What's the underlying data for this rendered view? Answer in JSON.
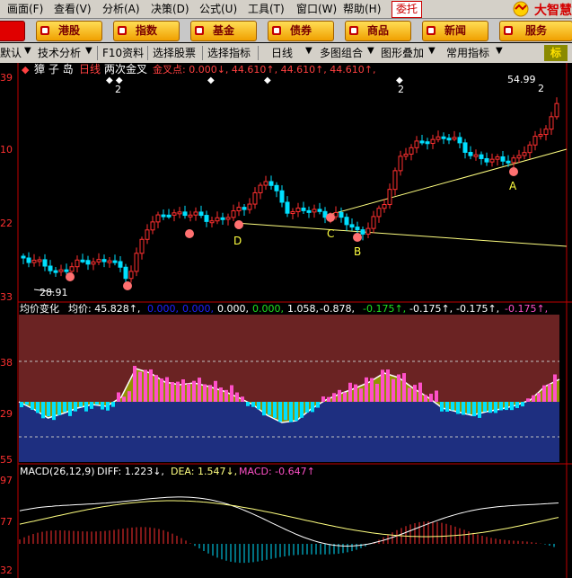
{
  "menu": {
    "items": [
      {
        "label": "画面(F)"
      },
      {
        "label": "查看(V)"
      },
      {
        "label": "分析(A)"
      },
      {
        "label": "决策(D)"
      },
      {
        "label": "公式(U)"
      },
      {
        "label": "工具(T)"
      },
      {
        "label": "窗口(W)"
      },
      {
        "label": "帮助(H)"
      }
    ],
    "entrust": "委托",
    "brand": "大智慧"
  },
  "nav": {
    "buttons": [
      {
        "label": "港股"
      },
      {
        "label": "指数"
      },
      {
        "label": "基金"
      },
      {
        "label": "债券"
      },
      {
        "label": "商品"
      },
      {
        "label": "新闻"
      },
      {
        "label": "服务"
      }
    ]
  },
  "toolbar": {
    "default": "默认",
    "analysis": "技术分析",
    "f10": "F10资料",
    "pick_stock": "选择股票",
    "pick_indicator": "选择指标",
    "period": "日线",
    "multi_chart": "多图组合",
    "overlay": "图形叠加",
    "common_indicator": "常用指标",
    "corner": "标"
  },
  "main": {
    "title_stock": "獐 子 岛",
    "title_period": "日线",
    "title_indicator": "两次金叉",
    "title_values": "金叉点: 0.000↓, 44.610↑, 44.610↑, 44.610↑,",
    "axis": {
      "top": "39",
      "mid": "10",
      "low": "22",
      "bottom": "33"
    },
    "high_marker": "54.99",
    "low_marker": "28.91",
    "labels": {
      "A": "A",
      "B": "B",
      "C": "C",
      "D": "D"
    },
    "num_labels": [
      "2",
      "2",
      "2",
      "2"
    ]
  },
  "avg": {
    "title": "均价变化",
    "label": "均价: 45.828↑,",
    "v1": "0.000,",
    "v2": "0.000,",
    "v3": "0.000,",
    "v4": "0.000,",
    "v5": "1.058,",
    "v6": "-0.878,",
    "v7": "-0.175↑,",
    "v8": "-0.175↑,",
    "v9": "-0.175↑,",
    "v10": "-0.175↑,",
    "axis": {
      "a": "38",
      "b": "29",
      "c": "55"
    }
  },
  "macd": {
    "title": "MACD(26,12,9)",
    "diff": "DIFF: 1.223↓,",
    "dea": "DEA: 1.547↓,",
    "macd": "MACD: -0.647↑",
    "axis": {
      "a": "97",
      "b": "77",
      "c": "32"
    }
  },
  "colors": {
    "up": "#ff3030",
    "down": "#00e0ff",
    "yellow_line": "#ffff80",
    "panel_red": "#6b2323",
    "panel_blue": "#1e2f80",
    "olive": "#98a000",
    "magenta": "#ff50c8"
  }
}
